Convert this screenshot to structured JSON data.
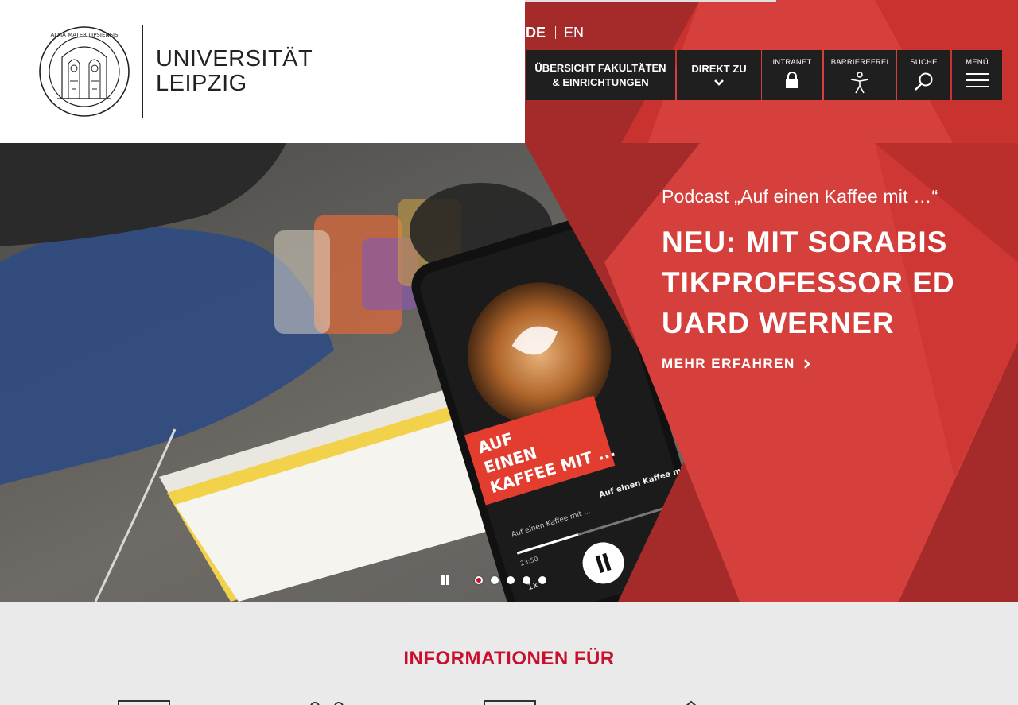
{
  "header": {
    "logo_line1": "UNIVERSITÄT",
    "logo_line2": "LEIPZIG",
    "seal_text": "ALMA MATER LIPSIENSIS",
    "languages": [
      {
        "label": "DE",
        "active": true
      },
      {
        "label": "EN",
        "active": false
      }
    ],
    "toolbar": {
      "overview_line1": "ÜBERSICHT FAKULTÄTEN",
      "overview_line2": "& EINRICHTUNGEN",
      "direkt": "DIREKT ZU",
      "intranet": "INTRANET",
      "barrierefrei": "BARRIEREFREI",
      "suche": "SUCHE",
      "menu": "MENÜ"
    }
  },
  "hero": {
    "kicker": "Podcast „Auf einen Kaffee mit …“",
    "title": "NEU: MIT SORABISTIKPROFESSOR EDUARD WERNER",
    "more": "MEHR ERFAHREN",
    "phone_banner": [
      "AUF",
      "EINEN",
      "KAFFEE MIT ..."
    ],
    "phone_track": "Auf einen Kaffee mit",
    "phone_sub": "Auf einen Kaffee mit ...",
    "phone_time": "23:50",
    "phone_speed": "1x",
    "slides_count": 5,
    "active_slide": 1
  },
  "colors": {
    "brand_red": "#c8102e",
    "red_dark": "#a52a2a",
    "red_light": "#d9413e",
    "toolbar_bg": "#1f1f1f"
  },
  "info": {
    "title": "INFORMATIONEN FÜR"
  }
}
